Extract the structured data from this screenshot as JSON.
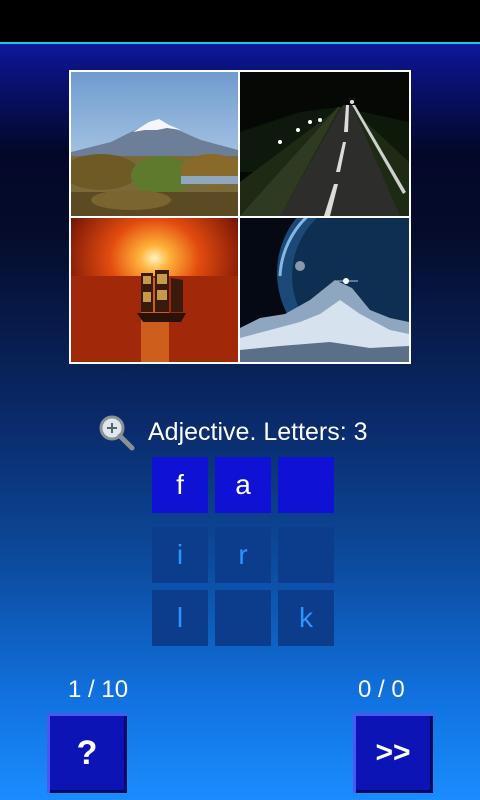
{
  "hint": {
    "text": "Adjective. Letters: 3"
  },
  "answer": [
    "f",
    "a",
    ""
  ],
  "letters": [
    "i",
    "r",
    "",
    "l",
    "",
    "k"
  ],
  "progress": "1 / 10",
  "score": "0 / 0",
  "buttons": {
    "help": "?",
    "next": ">>"
  },
  "icons": {
    "hint": "magnifier-zoom-icon"
  },
  "images": [
    "mountain-landscape",
    "road-at-night",
    "ship-at-sunset",
    "planet-in-space"
  ],
  "colors": {
    "answer_cell": "#0f12d4",
    "letter_cell": "#0c3d8c",
    "letter_text": "#2e92ff",
    "button": "#0d14b5",
    "accent_line": "#19c7f0"
  }
}
